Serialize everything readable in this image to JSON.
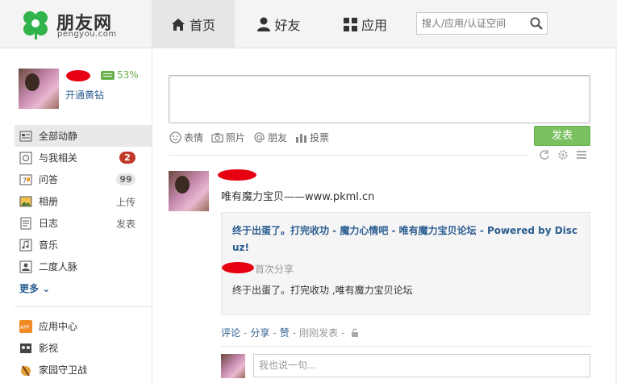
{
  "header": {
    "logo_text": "朋友网",
    "logo_sub": "pengyou.com",
    "tabs": [
      {
        "label": "首页",
        "icon": "home-icon",
        "active": true
      },
      {
        "label": "好友",
        "icon": "person-icon",
        "active": false
      },
      {
        "label": "应用",
        "icon": "apps-grid-icon",
        "active": false
      }
    ],
    "search_placeholder": "搜人/应用/认证空间"
  },
  "profile": {
    "vip_percent": "53%",
    "vip_open_link": "开通黄钻"
  },
  "sidebar": {
    "items": [
      {
        "label": "全部动静",
        "icon": "feed-icon",
        "active": true
      },
      {
        "label": "与我相关",
        "icon": "mention-icon",
        "badge": "2"
      },
      {
        "label": "问答",
        "icon": "qa-icon",
        "count": "99"
      },
      {
        "label": "相册",
        "icon": "photo-album-icon",
        "action": "上传"
      },
      {
        "label": "日志",
        "icon": "blog-icon",
        "action": "发表"
      },
      {
        "label": "音乐",
        "icon": "music-icon"
      },
      {
        "label": "二度人脉",
        "icon": "contacts-icon"
      }
    ],
    "more_label": "更多",
    "apps": [
      {
        "label": "应用中心",
        "icon": "app-center-icon"
      },
      {
        "label": "影视",
        "icon": "video-icon"
      },
      {
        "label": "家园守卫战",
        "icon": "game-icon"
      }
    ]
  },
  "composer": {
    "tools": [
      "表情",
      "照片",
      "朋友",
      "投票"
    ],
    "post_label": "发表"
  },
  "feed": {
    "text": "唯有魔力宝贝——www.pkml.cn",
    "share_title": "终于出蛋了。打完收功 - 魔力心情吧 - 唯有魔力宝贝论坛 - Powered by Discuz!",
    "share_first": "首次分享",
    "share_desc": "终于出蛋了。打完收功 ,唯有魔力宝贝论坛",
    "actions": {
      "comment": "评论",
      "share": "分享",
      "like": "赞",
      "time": "刚刚发表"
    },
    "comment_placeholder": "我也说一句..."
  },
  "colors": {
    "accent": "#2b5e91",
    "post_button": "#7ac060",
    "badge_red": "#c0392b",
    "brand_green": "#2fb34a"
  }
}
